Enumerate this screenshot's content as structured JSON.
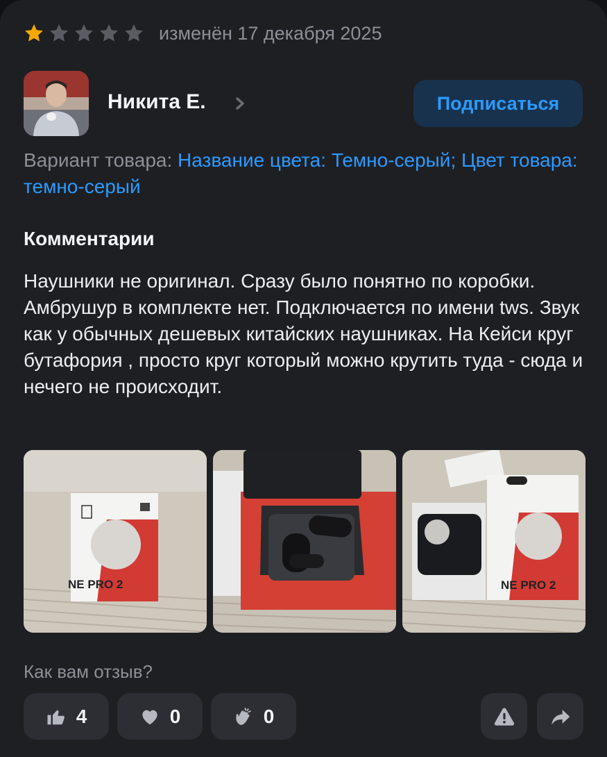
{
  "review": {
    "rating": 1,
    "rating_max": 5,
    "date": "изменён 17 декабря 2025",
    "colors": {
      "star_filled": "#f7a800",
      "star_empty": "#5a5c62",
      "accent": "#2b9bff"
    }
  },
  "author": {
    "name": "Никита Е.",
    "subscribe_label": "Подписаться",
    "chevron_icon": "chevron-right-icon"
  },
  "variant": {
    "label": "Вариант товара:",
    "value": "Название цвета: Темно-серый; Цвет товара: темно-серый"
  },
  "comments": {
    "title": "Комментарии",
    "text": "Наушники не оригинал. Сразу было понятно по коробки. Амбрушур в комплекте нет. Подключается по имени tws. Звук как у обычных дешевых китайских наушниках. На Кейси круг бутафория , просто круг который можно крутить туда - сюда и нечего не происходит."
  },
  "photos": [
    {
      "box_text": "NE PRO 2"
    },
    {
      "box_text": ""
    },
    {
      "box_text": "NE PRO 2"
    }
  ],
  "feedback": {
    "question": "Как вам отзыв?",
    "reactions": [
      {
        "icon": "thumbs-up-icon",
        "count": "4"
      },
      {
        "icon": "heart-icon",
        "count": "0"
      },
      {
        "icon": "clap-icon",
        "count": "0"
      }
    ],
    "actions": [
      {
        "icon": "warning-icon"
      },
      {
        "icon": "share-icon"
      }
    ]
  }
}
